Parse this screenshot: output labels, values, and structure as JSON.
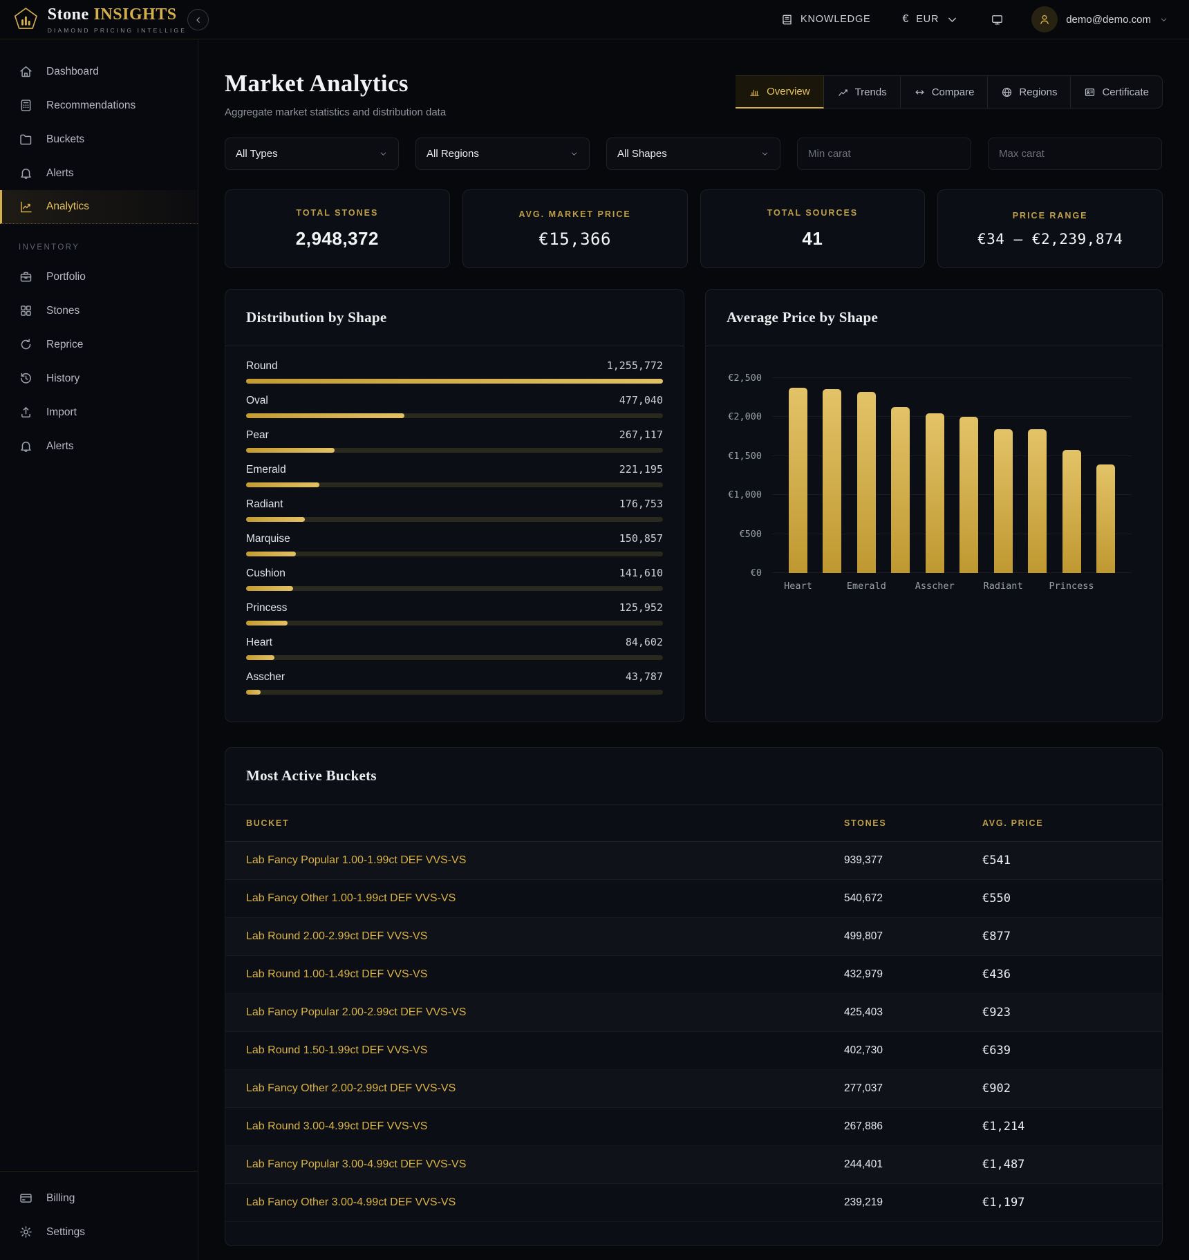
{
  "brand": {
    "name_primary": "Stone",
    "name_accent": "INSIGHTS",
    "tagline": "DIAMOND PRICING INTELLIGE"
  },
  "header": {
    "knowledge_label": "KNOWLEDGE",
    "currency_symbol": "€",
    "currency_code": "EUR",
    "user_email": "demo@demo.com"
  },
  "colors": {
    "accent_gold": "#d4af50",
    "panel_bg": "#0c0e15",
    "page_bg": "#07080c",
    "bar_track": "#2a291d"
  },
  "sidebar": {
    "main_items": [
      {
        "label": "Dashboard",
        "icon": "home",
        "active": false
      },
      {
        "label": "Recommendations",
        "icon": "calculator",
        "active": false
      },
      {
        "label": "Buckets",
        "icon": "folder",
        "active": false
      },
      {
        "label": "Alerts",
        "icon": "bell",
        "active": false
      },
      {
        "label": "Analytics",
        "icon": "analytics",
        "active": true
      }
    ],
    "section_label": "INVENTORY",
    "inventory_items": [
      {
        "label": "Portfolio",
        "icon": "briefcase",
        "active": false
      },
      {
        "label": "Stones",
        "icon": "grid",
        "active": false
      },
      {
        "label": "Reprice",
        "icon": "refresh",
        "active": false
      },
      {
        "label": "History",
        "icon": "history",
        "active": false
      },
      {
        "label": "Import",
        "icon": "upload",
        "active": false
      },
      {
        "label": "Alerts",
        "icon": "bell",
        "active": false
      }
    ],
    "footer_items": [
      {
        "label": "Billing",
        "icon": "card",
        "active": false
      },
      {
        "label": "Settings",
        "icon": "gear",
        "active": false
      }
    ]
  },
  "page": {
    "title": "Market Analytics",
    "subtitle": "Aggregate market statistics and distribution data"
  },
  "tabs": [
    {
      "label": "Overview",
      "icon": "bars",
      "active": true
    },
    {
      "label": "Trends",
      "icon": "trend",
      "active": false
    },
    {
      "label": "Compare",
      "icon": "compare",
      "active": false
    },
    {
      "label": "Regions",
      "icon": "globe",
      "active": false
    },
    {
      "label": "Certificate",
      "icon": "certificate",
      "active": false
    }
  ],
  "filters": {
    "type_value": "All Types",
    "region_value": "All Regions",
    "shape_value": "All Shapes",
    "min_carat_placeholder": "Min carat",
    "max_carat_placeholder": "Max carat"
  },
  "stats": [
    {
      "label": "TOTAL STONES",
      "value": "2,948,372",
      "mono": false,
      "small": false
    },
    {
      "label": "AVG. MARKET PRICE",
      "value": "€15,366",
      "mono": true,
      "small": false
    },
    {
      "label": "TOTAL SOURCES",
      "value": "41",
      "mono": false,
      "small": false
    },
    {
      "label": "PRICE RANGE",
      "value": "€34 – €2,239,874",
      "mono": true,
      "small": true
    }
  ],
  "chart_data": [
    {
      "type": "bar",
      "orientation": "horizontal",
      "title": "Distribution by Shape",
      "items": [
        {
          "label": "Round",
          "value": 1255772,
          "display": "1,255,772"
        },
        {
          "label": "Oval",
          "value": 477040,
          "display": "477,040"
        },
        {
          "label": "Pear",
          "value": 267117,
          "display": "267,117"
        },
        {
          "label": "Emerald",
          "value": 221195,
          "display": "221,195"
        },
        {
          "label": "Radiant",
          "value": 176753,
          "display": "176,753"
        },
        {
          "label": "Marquise",
          "value": 150857,
          "display": "150,857"
        },
        {
          "label": "Cushion",
          "value": 141610,
          "display": "141,610"
        },
        {
          "label": "Princess",
          "value": 125952,
          "display": "125,952"
        },
        {
          "label": "Heart",
          "value": 84602,
          "display": "84,602"
        },
        {
          "label": "Asscher",
          "value": 43787,
          "display": "43,787"
        }
      ]
    },
    {
      "type": "bar",
      "title": "Average Price by Shape",
      "values": [
        2380,
        2360,
        2320,
        2130,
        2050,
        2000,
        1845,
        1840,
        1580,
        1390
      ],
      "x_labels": [
        "Heart",
        "",
        "Emerald",
        "",
        "Asscher",
        "",
        "Radiant",
        "",
        "Princess",
        ""
      ],
      "ylim": [
        0,
        2500
      ],
      "yticks": [
        "€0",
        "€500",
        "€1,000",
        "€1,500",
        "€2,000",
        "€2,500"
      ],
      "ytick_values": [
        0,
        500,
        1000,
        1500,
        2000,
        2500
      ],
      "grid": true,
      "legend": false
    }
  ],
  "buckets": {
    "title": "Most Active Buckets",
    "columns": {
      "bucket": "BUCKET",
      "stones": "STONES",
      "price": "AVG. PRICE"
    },
    "rows": [
      {
        "bucket": "Lab Fancy Popular 1.00-1.99ct DEF VVS-VS",
        "stones": "939,377",
        "price": "€541"
      },
      {
        "bucket": "Lab Fancy Other 1.00-1.99ct DEF VVS-VS",
        "stones": "540,672",
        "price": "€550"
      },
      {
        "bucket": "Lab Round 2.00-2.99ct DEF VVS-VS",
        "stones": "499,807",
        "price": "€877"
      },
      {
        "bucket": "Lab Round 1.00-1.49ct DEF VVS-VS",
        "stones": "432,979",
        "price": "€436"
      },
      {
        "bucket": "Lab Fancy Popular 2.00-2.99ct DEF VVS-VS",
        "stones": "425,403",
        "price": "€923"
      },
      {
        "bucket": "Lab Round 1.50-1.99ct DEF VVS-VS",
        "stones": "402,730",
        "price": "€639"
      },
      {
        "bucket": "Lab Fancy Other 2.00-2.99ct DEF VVS-VS",
        "stones": "277,037",
        "price": "€902"
      },
      {
        "bucket": "Lab Round 3.00-4.99ct DEF VVS-VS",
        "stones": "267,886",
        "price": "€1,214"
      },
      {
        "bucket": "Lab Fancy Popular 3.00-4.99ct DEF VVS-VS",
        "stones": "244,401",
        "price": "€1,487"
      },
      {
        "bucket": "Lab Fancy Other 3.00-4.99ct DEF VVS-VS",
        "stones": "239,219",
        "price": "€1,197"
      }
    ]
  }
}
